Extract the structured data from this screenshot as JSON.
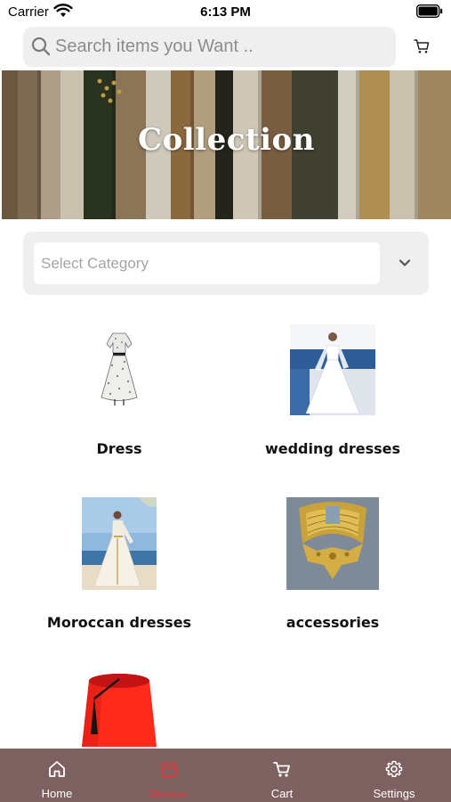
{
  "status_bar": {
    "carrier": "Carrier",
    "time": "6:13 PM"
  },
  "search": {
    "placeholder": "Search items you Want .."
  },
  "banner": {
    "title": "Collection"
  },
  "category": {
    "placeholder": "Select Category"
  },
  "categories": [
    {
      "label": "Dress",
      "icon": "dress-image"
    },
    {
      "label": "wedding dresses",
      "icon": "wedding-dress-image"
    },
    {
      "label": "Moroccan dresses",
      "icon": "moroccan-dress-image"
    },
    {
      "label": "accessories",
      "icon": "accessories-image"
    },
    {
      "label": "",
      "icon": "fez-hat-image"
    }
  ],
  "tabs": [
    {
      "label": "Home",
      "icon": "home-icon",
      "active": false
    },
    {
      "label": "Browse",
      "icon": "calendar-icon",
      "active": true
    },
    {
      "label": "Cart",
      "icon": "cart-icon",
      "active": false
    },
    {
      "label": "Settings",
      "icon": "gear-icon",
      "active": false
    }
  ],
  "colors": {
    "tab_bar": "#7d6060",
    "active_tab": "#d63b3b",
    "search_bg": "#efefef"
  }
}
